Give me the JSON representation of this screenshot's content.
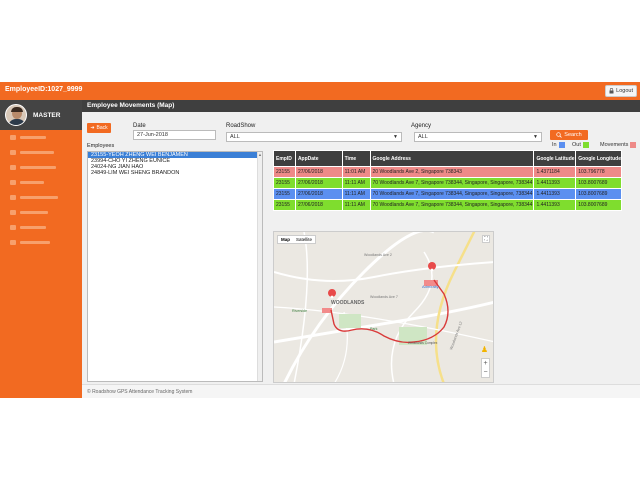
{
  "header": {
    "employee_id_label": "EmployeeID:",
    "employee_id_value": "1027_9999",
    "logout_label": "Logout"
  },
  "sidebar": {
    "user_name": "MASTER",
    "items": [
      {
        "icon": "menu-item-icon"
      },
      {
        "icon": "menu-item-icon"
      },
      {
        "icon": "menu-item-icon"
      },
      {
        "icon": "menu-item-icon"
      },
      {
        "icon": "menu-item-icon"
      },
      {
        "icon": "menu-item-icon"
      },
      {
        "icon": "menu-item-icon"
      },
      {
        "icon": "menu-item-icon"
      }
    ]
  },
  "panel": {
    "title": "Employee Movements (Map)"
  },
  "form": {
    "back_label": "Back",
    "date_label": "Date",
    "date_value": "27-Jun-2018",
    "roadshow_label": "RoadShow",
    "roadshow_value": "ALL",
    "agency_label": "Agency",
    "agency_value": "ALL",
    "search_label": "Search",
    "employees_label": "Employees"
  },
  "legend": {
    "in_label": "In",
    "out_label": "Out",
    "movements_label": "Movements",
    "in_color": "#5b8ff0",
    "out_color": "#7fdd2e",
    "movements_color": "#ee8a88"
  },
  "employees": [
    "23155-YEOH ZHENG WEI BENJAMEN",
    "23994-CHO YI ZHENG EUNICE",
    "24024-NG JIAN HAO",
    "24849-LIM WEI SHENG BRANDON"
  ],
  "table": {
    "headers": [
      "EmpID",
      "AppDate",
      "Time",
      "Google Address",
      "Google Latitude",
      "Google Longitude"
    ],
    "rows": [
      {
        "type": "movement",
        "cells": [
          "23155",
          "27/06/2018",
          "11:01 AM",
          "20 Woodlands Ave 2, Singapore 738343",
          "1.4371184",
          "103.796778"
        ]
      },
      {
        "type": "out",
        "cells": [
          "23155",
          "27/06/2018",
          "11:11 AM",
          "70 Woodlands Ave 7, Singapore 738344, Singapore, Singapore, 738344",
          "1.4411393",
          "103.8007689"
        ]
      },
      {
        "type": "in",
        "cells": [
          "23155",
          "27/06/2018",
          "11:11 AM",
          "70 Woodlands Ave 7, Singapore 738344, Singapore, Singapore, 738344",
          "1.4411393",
          "103.8007689"
        ]
      },
      {
        "type": "out",
        "cells": [
          "23155",
          "27/06/2018",
          "11:11 AM",
          "70 Woodlands Ave 7, Singapore 738344, Singapore, Singapore, 738344",
          "1.4411393",
          "103.8007689"
        ]
      }
    ]
  },
  "map": {
    "tab_map": "Map",
    "tab_satellite": "Satellite",
    "labels": {
      "woodlands": "WOODLANDS",
      "admiralty": "Admiralty",
      "woodlands_ave7": "Woodlands Ave 7",
      "woodlands_ave12": "Woodlands Ave 12",
      "woodlands_ave2": "Woodlands Ave 2",
      "riverside": "Riverside",
      "park": "Park",
      "complex": "Woodlands Complex"
    },
    "route_color": "#d93a3a",
    "marker_color": "#e84a4a"
  },
  "footer": {
    "text": "© Roadshow GPS Attendance Tracking System"
  }
}
